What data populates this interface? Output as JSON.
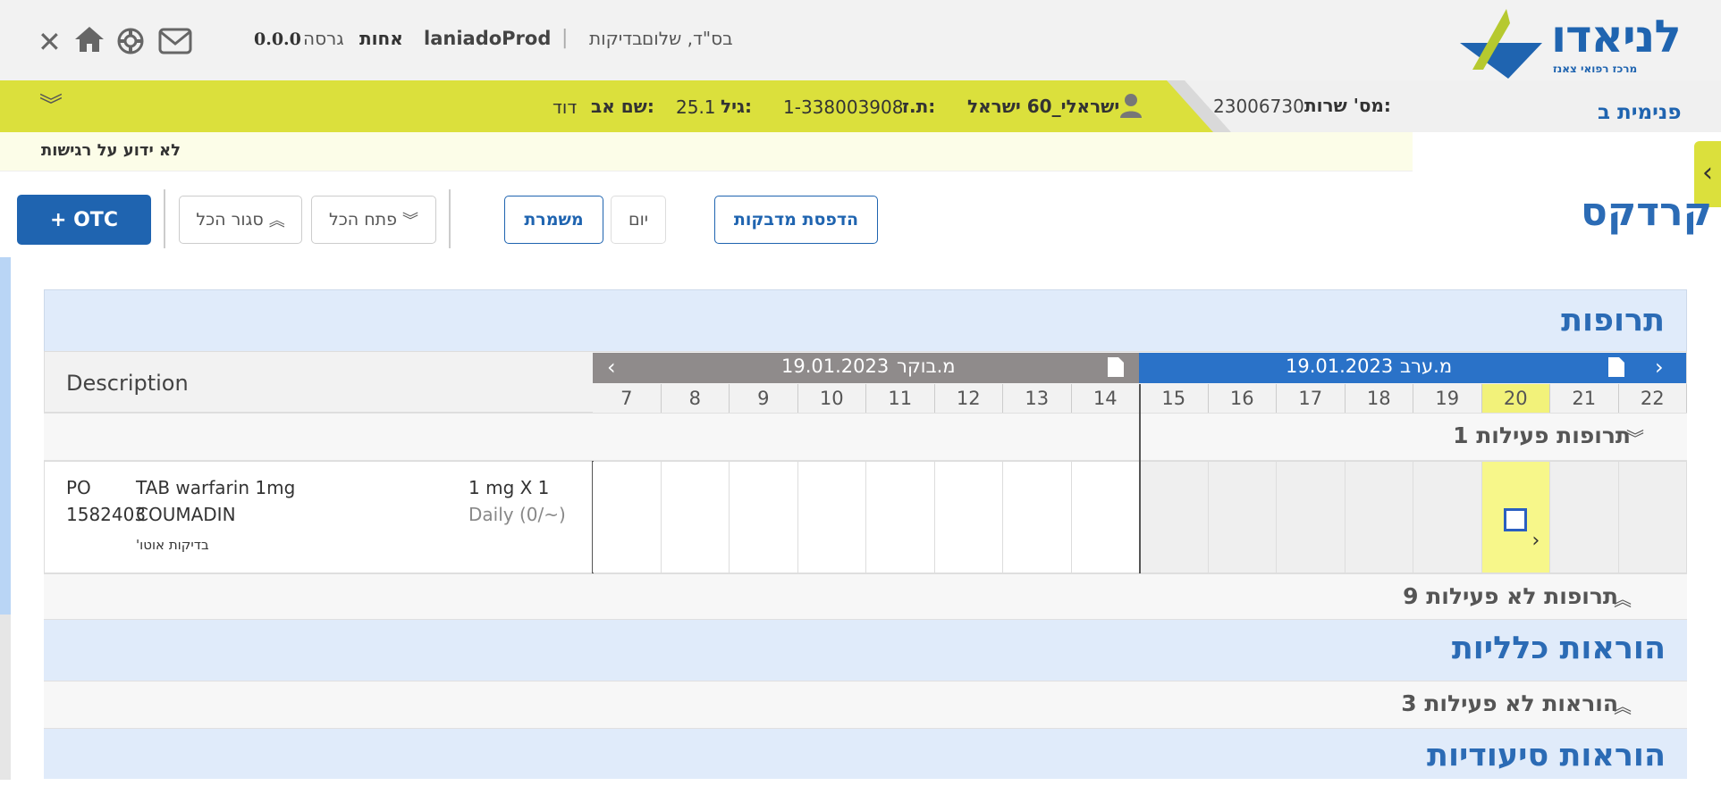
{
  "header": {
    "greeting": "בס\"ד, שלום",
    "user": "בדיקות",
    "env": "laniadoProd",
    "role": "אחות",
    "version_label": "גרסה",
    "version": "0.0.0",
    "logo_text": "לניאדו",
    "logo_sub": "מרכז רפואי צאנז"
  },
  "patient": {
    "department": "פנימית ב",
    "service_label": "מס' שרות:",
    "service_no": "23006730",
    "name": "ישראלי_60 ישראל",
    "id_label": "ת.ז:",
    "id": "1-338003908",
    "age_label": "גיל:",
    "age": "25.1",
    "father_label": "שם אב:",
    "father": "דוד"
  },
  "allergy": "לא ידוע על רגישות",
  "page": {
    "title": "קרדקס",
    "print_labels": "הדפסת מדבקות",
    "day": "יום",
    "shift": "משמרת",
    "open_all": "פתח הכל",
    "close_all": "סגור הכל",
    "otc": "+ OTC"
  },
  "meds": {
    "title": "תרופות",
    "description_header": "Description",
    "morning_shift": "מ.בוקר",
    "morning_date": "19.01.2023",
    "evening_shift": "מ.ערב",
    "evening_date": "19.01.2023",
    "hours": [
      "7",
      "8",
      "9",
      "10",
      "11",
      "12",
      "13",
      "14",
      "15",
      "16",
      "17",
      "18",
      "19",
      "20",
      "21",
      "22"
    ],
    "active_group": "1 תרופות פעילות",
    "row": {
      "route": "PO",
      "code": "1582403",
      "drug": "TAB warfarin 1mg",
      "brand": "COUMADIN",
      "note": "'בדיקות אוטו",
      "dose": "1 mg X 1",
      "freq": "Daily (0/~)"
    },
    "inactive_group": "9 תרופות לא פעילות"
  },
  "general": {
    "title": "הוראות כלליות",
    "inactive_group": "3 הוראות לא פעילות"
  },
  "nursing": {
    "title": "הוראות סיעודיות"
  },
  "colors": {
    "brand_blue": "#1f64b0",
    "lime": "#dbe03c",
    "section_bg": "#e0ebfa",
    "highlight": "#f7f78a"
  }
}
